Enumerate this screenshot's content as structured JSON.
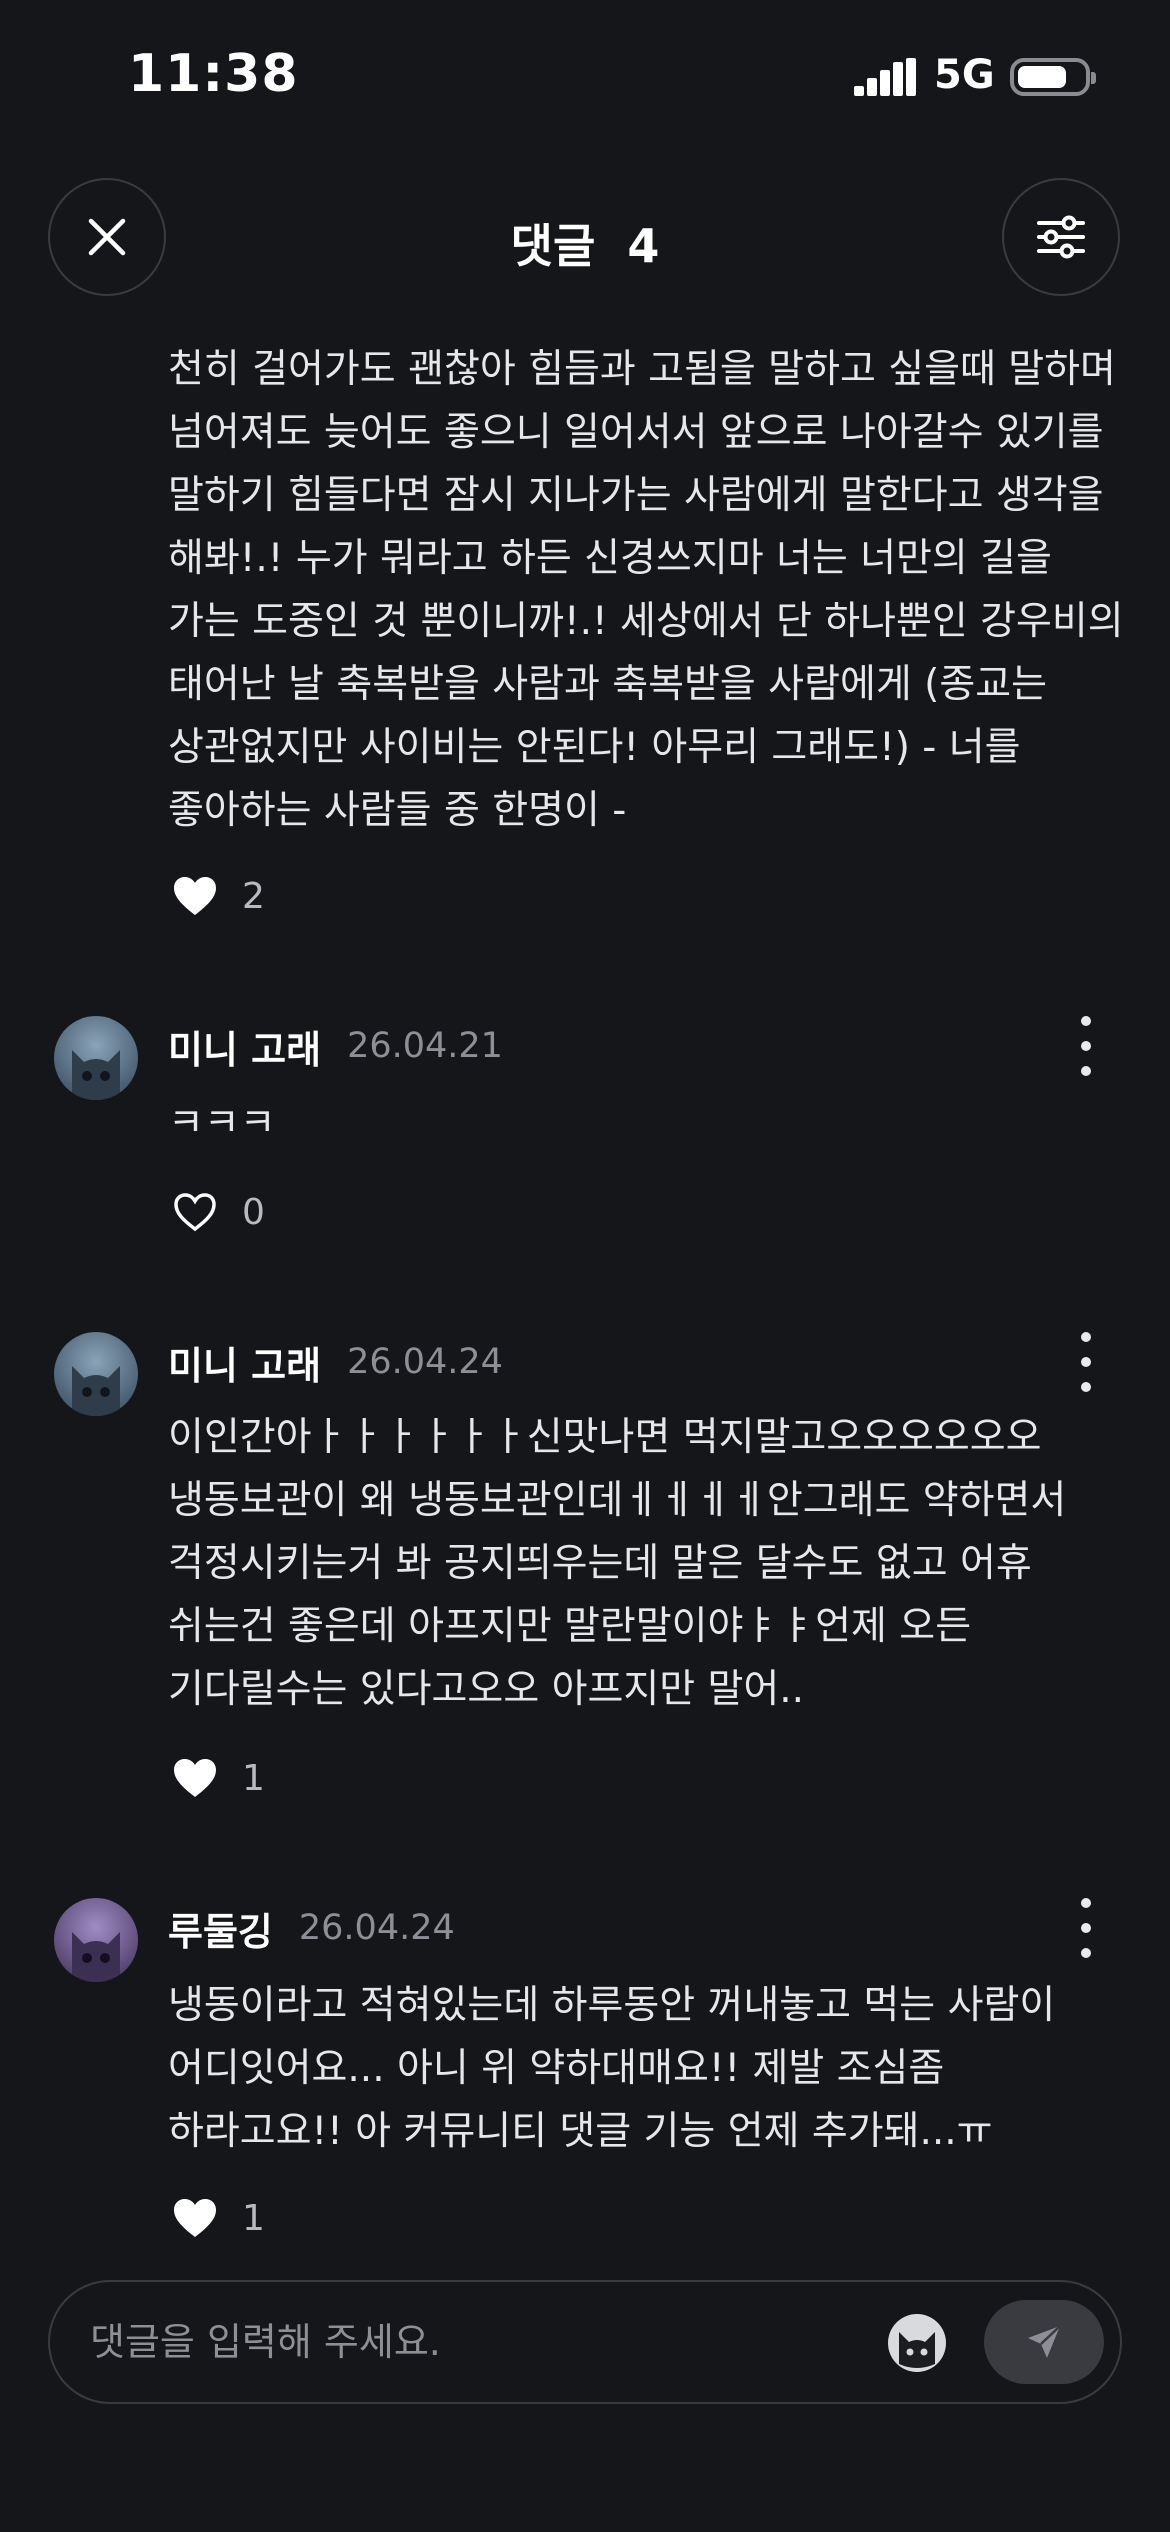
{
  "status_bar": {
    "time": "11:38",
    "network": "5G"
  },
  "header": {
    "title": "댓글",
    "count": "4"
  },
  "comments": [
    {
      "text": "천히 걸어가도 괜찮아 힘듬과 고됨을 말하고 싶을때 말하며 넘어져도 늦어도 좋으니 일어서서 앞으로 나아갈수 있기를 말하기 힘들다면 잠시 지나가는 사람에게 말한다고 생각을 해봐!.! 누가 뭐라고 하든 신경쓰지마 너는 너만의 길을 가는 도중인 것 뿐이니까!.! 세상에서 단 하나뿐인 강우비의 태어난 날 축복받을 사람과 축복받을 사람에게 (종교는 상관없지만 사이비는 안된다! 아무리 그래도!) - 너를 좋아하는 사람들 중 한명이 -",
      "likes": "2",
      "liked": true
    },
    {
      "author": "미니 고래",
      "date": "26.04.21",
      "text": "ㅋㅋㅋ",
      "likes": "0",
      "liked": false
    },
    {
      "author": "미니 고래",
      "date": "26.04.24",
      "text": "이인간아ㅏㅏㅏㅏㅏㅏ신맛나면 먹지말고오오오오오오 냉동보관이 왜 냉동보관인데ㅔㅔㅔㅔ안그래도 약하면서 걱정시키는거 봐 공지띄우는데 말은 달수도 없고 어휴 쉬는건 좋은데 아프지만 말란말이야ㅑㅑ언제 오든 기다릴수는 있다고오오 아프지만 말어..",
      "likes": "1",
      "liked": true
    },
    {
      "author": "루둘깅",
      "date": "26.04.24",
      "text": "냉동이라고 적혀있는데 하루동안 꺼내놓고 먹는 사람이 어디잇어요... 아니 위 약하대매요!! 제발 조심좀 하라고요!! 아 커뮤니티 댓글 기능 언제 추가돼...ㅠ",
      "likes": "1",
      "liked": true
    }
  ],
  "input": {
    "placeholder": "댓글을 입력해 주세요."
  },
  "colors": {
    "background": "#151619",
    "text": "#e9eaee",
    "muted": "#8e8f96",
    "avatar_blue": "#5d7388",
    "avatar_purple": "#6d5a8e"
  }
}
